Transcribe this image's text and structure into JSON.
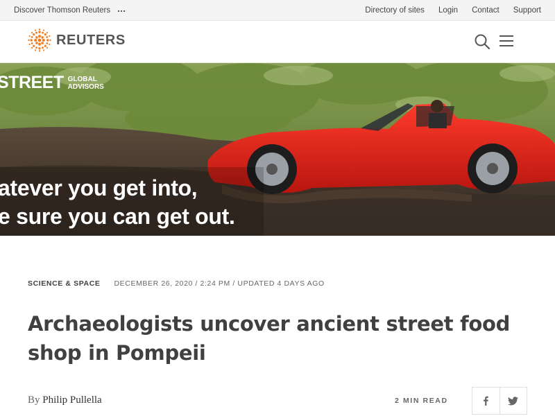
{
  "utility_bar": {
    "discover_label": "Discover Thomson Reuters",
    "more_icon": "ellipsis-icon",
    "links": [
      "Directory of sites",
      "Login",
      "Contact",
      "Support"
    ]
  },
  "header": {
    "logo_text": "REUTERS",
    "logo_color": "#f07d22",
    "search_icon": "search-icon",
    "menu_icon": "hamburger-menu-icon"
  },
  "ad": {
    "brand_name": "STREET",
    "brand_sub": "GLOBAL ADVISORS",
    "line1": "atever you get into,",
    "line2": "e sure you can get out."
  },
  "article": {
    "section": "SCIENCE & SPACE",
    "date": "DECEMBER 26, 2020 / 2:24 PM / UPDATED 4 DAYS AGO",
    "headline": "Archaeologists uncover ancient street food shop in Pompeii",
    "byline_prefix": "By",
    "author": "Philip Pullella",
    "read_time": "2 MIN READ",
    "share": [
      "facebook-icon",
      "twitter-icon"
    ]
  }
}
